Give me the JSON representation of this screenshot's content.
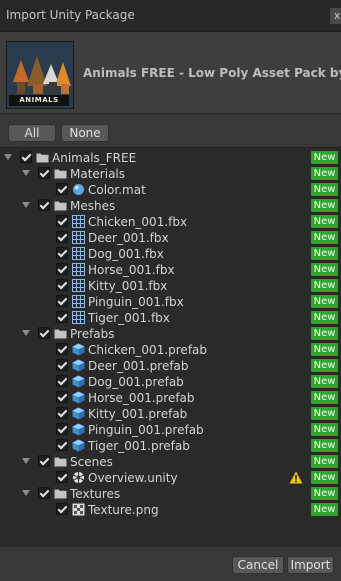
{
  "window": {
    "title": "Import Unity Package",
    "close_glyph": "x"
  },
  "package": {
    "thumbnail_caption": "ANIMALS",
    "name": "Animals FREE - Low Poly Asset Pack by ith"
  },
  "selection": {
    "all_label": "All",
    "none_label": "None"
  },
  "tree": [
    {
      "depth": 0,
      "type": "folder",
      "label": "Animals_FREE",
      "checked": true,
      "expanded": true,
      "badge": "New",
      "warning": false
    },
    {
      "depth": 1,
      "type": "folder",
      "label": "Materials",
      "checked": true,
      "expanded": true,
      "badge": "New",
      "warning": false
    },
    {
      "depth": 2,
      "type": "material",
      "label": "Color.mat",
      "checked": true,
      "badge": "New",
      "warning": false
    },
    {
      "depth": 1,
      "type": "folder",
      "label": "Meshes",
      "checked": true,
      "expanded": true,
      "badge": "New",
      "warning": false
    },
    {
      "depth": 2,
      "type": "mesh",
      "label": "Chicken_001.fbx",
      "checked": true,
      "badge": "New",
      "warning": false
    },
    {
      "depth": 2,
      "type": "mesh",
      "label": "Deer_001.fbx",
      "checked": true,
      "badge": "New",
      "warning": false
    },
    {
      "depth": 2,
      "type": "mesh",
      "label": "Dog_001.fbx",
      "checked": true,
      "badge": "New",
      "warning": false
    },
    {
      "depth": 2,
      "type": "mesh",
      "label": "Horse_001.fbx",
      "checked": true,
      "badge": "New",
      "warning": false
    },
    {
      "depth": 2,
      "type": "mesh",
      "label": "Kitty_001.fbx",
      "checked": true,
      "badge": "New",
      "warning": false
    },
    {
      "depth": 2,
      "type": "mesh",
      "label": "Pinguin_001.fbx",
      "checked": true,
      "badge": "New",
      "warning": false
    },
    {
      "depth": 2,
      "type": "mesh",
      "label": "Tiger_001.fbx",
      "checked": true,
      "badge": "New",
      "warning": false
    },
    {
      "depth": 1,
      "type": "folder",
      "label": "Prefabs",
      "checked": true,
      "expanded": true,
      "badge": "New",
      "warning": false
    },
    {
      "depth": 2,
      "type": "prefab",
      "label": "Chicken_001.prefab",
      "checked": true,
      "badge": "New",
      "warning": false
    },
    {
      "depth": 2,
      "type": "prefab",
      "label": "Deer_001.prefab",
      "checked": true,
      "badge": "New",
      "warning": false
    },
    {
      "depth": 2,
      "type": "prefab",
      "label": "Dog_001.prefab",
      "checked": true,
      "badge": "New",
      "warning": false
    },
    {
      "depth": 2,
      "type": "prefab",
      "label": "Horse_001.prefab",
      "checked": true,
      "badge": "New",
      "warning": false
    },
    {
      "depth": 2,
      "type": "prefab",
      "label": "Kitty_001.prefab",
      "checked": true,
      "badge": "New",
      "warning": false
    },
    {
      "depth": 2,
      "type": "prefab",
      "label": "Pinguin_001.prefab",
      "checked": true,
      "badge": "New",
      "warning": false
    },
    {
      "depth": 2,
      "type": "prefab",
      "label": "Tiger_001.prefab",
      "checked": true,
      "badge": "New",
      "warning": false
    },
    {
      "depth": 1,
      "type": "folder",
      "label": "Scenes",
      "checked": true,
      "expanded": true,
      "badge": "New",
      "warning": false
    },
    {
      "depth": 2,
      "type": "scene",
      "label": "Overview.unity",
      "checked": true,
      "badge": "New",
      "warning": true
    },
    {
      "depth": 1,
      "type": "folder",
      "label": "Textures",
      "checked": true,
      "expanded": true,
      "badge": "New",
      "warning": false
    },
    {
      "depth": 2,
      "type": "texture",
      "label": "Texture.png",
      "checked": true,
      "badge": "New",
      "warning": false
    }
  ],
  "footer": {
    "cancel_label": "Cancel",
    "import_label": "Import"
  },
  "colors": {
    "badge": "#2da42d",
    "tree_bg": "#2a2a2a",
    "window_bg": "#383838",
    "warning": "#f0c020"
  }
}
